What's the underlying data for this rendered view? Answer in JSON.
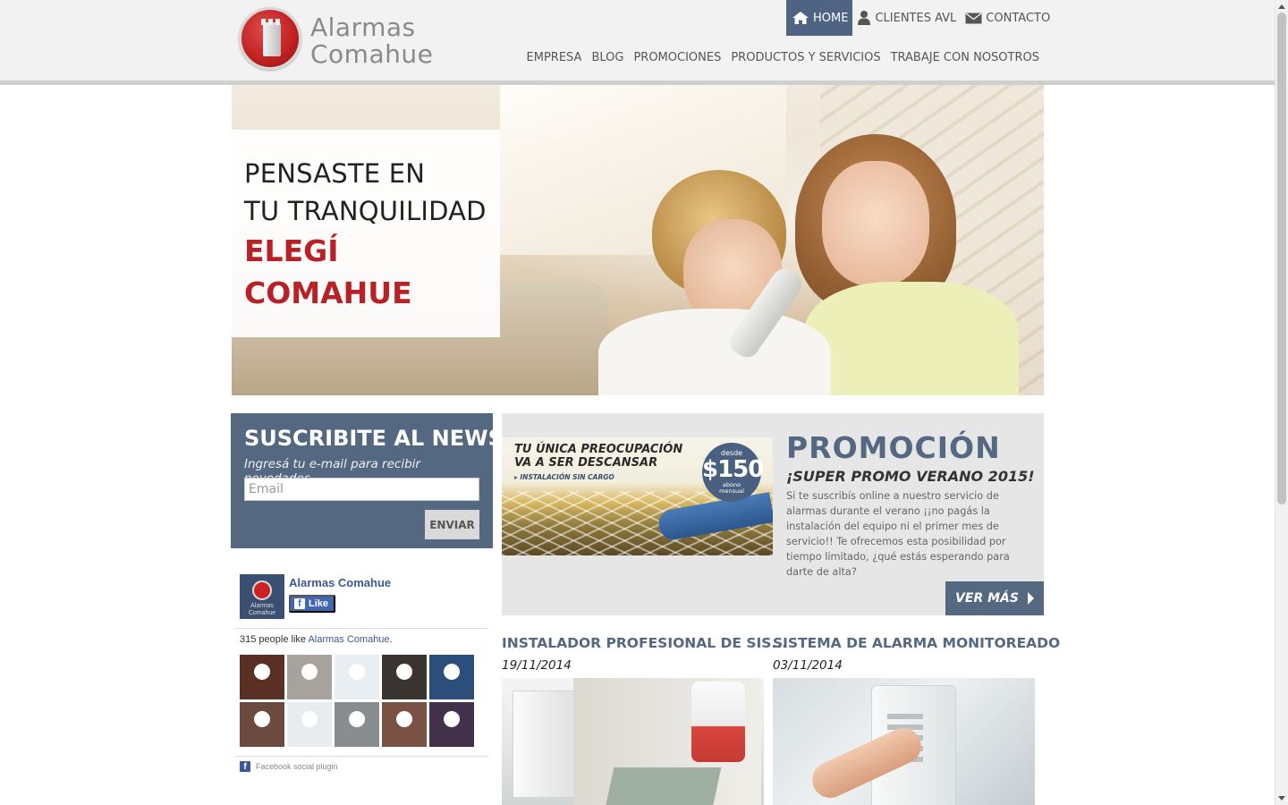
{
  "brand": {
    "name_line1": "Alarmas",
    "name_line2": "Comahue"
  },
  "top_nav": [
    {
      "label": "HOME",
      "icon": "home-icon",
      "active": true
    },
    {
      "label": "CLIENTES AVL",
      "icon": "user-icon"
    },
    {
      "label": "CONTACTO",
      "icon": "mail-icon"
    }
  ],
  "main_nav": [
    "EMPRESA",
    "BLOG",
    "PROMOCIONES",
    "PRODUCTOS Y SERVICIOS",
    "TRABAJE CON NOSOTROS"
  ],
  "hero": {
    "line1": "PENSASTE EN",
    "line2": "TU TRANQUILIDAD",
    "accent1": "ELEGÍ",
    "accent2": "COMAHUE"
  },
  "newsletter": {
    "title": "SUSCRIBITE AL NEWS",
    "subtitle": "Ingresá tu e-mail para recibir novedades",
    "email_placeholder": "Email",
    "email_value": "",
    "button": "ENVIAR"
  },
  "facebook": {
    "page_name": "Alarmas Comahue",
    "avatar_text": "Alarmas Comahue",
    "like_label": "Like",
    "like_count_prefix": "315 people like ",
    "like_count_link": "Alarmas Comahue",
    "like_count_suffix": ".",
    "plugin_label": "Facebook social plugin",
    "face_colors": [
      "#5a2f24",
      "#a7a39c",
      "#e8eef2",
      "#3a3430",
      "#2b4f7a",
      "#6d4a3f",
      "#e9ecef",
      "#8a8d90",
      "#7a5142",
      "#43304a"
    ]
  },
  "promo": {
    "image_title_line1": "TU ÚNICA PREOCUPACIÓN",
    "image_title_line2": "VA A SER DESCANSAR",
    "image_small": "▸ INSTALACIÓN SIN CARGO",
    "badge_top": "desde",
    "badge_price": "$150",
    "badge_bottom_line1": "abono",
    "badge_bottom_line2": "mensual",
    "heading": "PROMOCIÓN",
    "subheading": "¡SUPER PROMO VERANO 2015!",
    "text": "Si te suscribís online a nuestro servicio de alarmas durante el verano ¡¡no pagás la instalación del equipo ni el primer mes de servicio!! Te ofrecemos esta posibilidad por tiempo limitado, ¿qué estás esperando para darte de alta?",
    "button": "VER MÁS"
  },
  "posts": [
    {
      "title": "INSTALADOR PROFESIONAL DE SIS...",
      "date": "19/11/2014"
    },
    {
      "title": "SISTEMA DE ALARMA MONITOREADO",
      "date": "03/11/2014"
    }
  ],
  "colors": {
    "accent": "#546882",
    "brand_red": "#b82126",
    "nav_active": "#4f6482"
  }
}
